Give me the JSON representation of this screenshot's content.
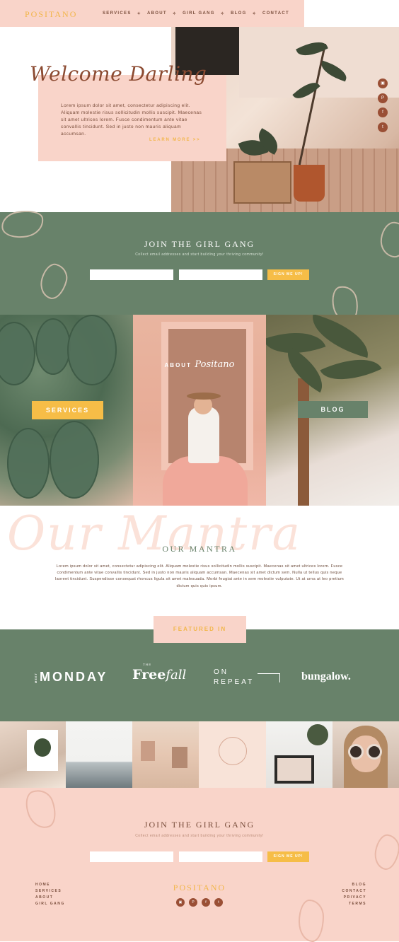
{
  "nav": {
    "logo": "POSITANO",
    "links": [
      "SERVICES",
      "ABOUT",
      "GIRL GANG",
      "BLOG",
      "CONTACT"
    ],
    "separator": "✧"
  },
  "hero": {
    "title": "Welcome Darling",
    "body": "Lorem ipsum dolor sit amet, consectetur adipiscing elit. Aliquam molestie risus sollicitudin mollis suscipit. Maecenas sit amet ultrices lorem. Fusce condimentum ante vitae convallis tincidunt. Sed in justo non mauris aliquam accumsan.",
    "cta": "LEARN MORE >>"
  },
  "social": {
    "icons": [
      "instagram-icon",
      "pinterest-icon",
      "facebook-icon",
      "twitter-icon"
    ],
    "glyphs": [
      "▣",
      "P",
      "f",
      "t"
    ]
  },
  "join": {
    "title": "JOIN THE GIRL GANG",
    "subtitle": "Collect email addresses and start building your thriving community!",
    "first_placeholder": "",
    "email_placeholder": "",
    "button": "SIGN ME UP!"
  },
  "panels": {
    "services_label": "SERVICES",
    "about_label": "ABOUT",
    "about_script": "Positano",
    "blog_label": "BLOG"
  },
  "mantra": {
    "script": "Our Mantra",
    "title": "OUR MANTRA",
    "body": "Lorem ipsum dolor sit amet, consectetur adipiscing elit. Aliquam molestie risus sollicitudin mollis suscipit. Maecenas sit amet ultrices lorem. Fusce condimentum ante vitae convallis tincidunt. Sed in justo non mauris aliquam accumsan. Maecenas sit amet dictum sem. Nulla ut tellus quis neque laoreet tincidunt. Suspendisse consequat rhoncus ligula sit amet malesuada. Morbi feugiat ante in sem molestie vulputate. Ut at urna at leo pretium dictum quis quis ipsum."
  },
  "featured": {
    "label": "FEATURED IN",
    "logos": {
      "monday_prefix": "MEET",
      "monday": "MONDAY",
      "free_prefix": "THE",
      "free": "Free",
      "free_script": "fall",
      "on": "ON",
      "repeat": "REPEAT",
      "bungalow": "bungalow."
    }
  },
  "footer": {
    "title": "JOIN THE GIRL GANG",
    "subtitle": "Collect email addresses and start building your thriving community!",
    "button": "SIGN ME UP!",
    "logo": "POSITANO",
    "left_links": [
      "HOME",
      "SERVICES",
      "ABOUT",
      "GIRL GANG"
    ],
    "right_links": [
      "BLOG",
      "CONTACT",
      "PRIVACY",
      "TERMS"
    ]
  },
  "colors": {
    "blush": "#f9d4c9",
    "sage": "#68826a",
    "mustard": "#f6bd47",
    "rust": "#9a4f35",
    "brown_text": "#7a4e3c"
  }
}
